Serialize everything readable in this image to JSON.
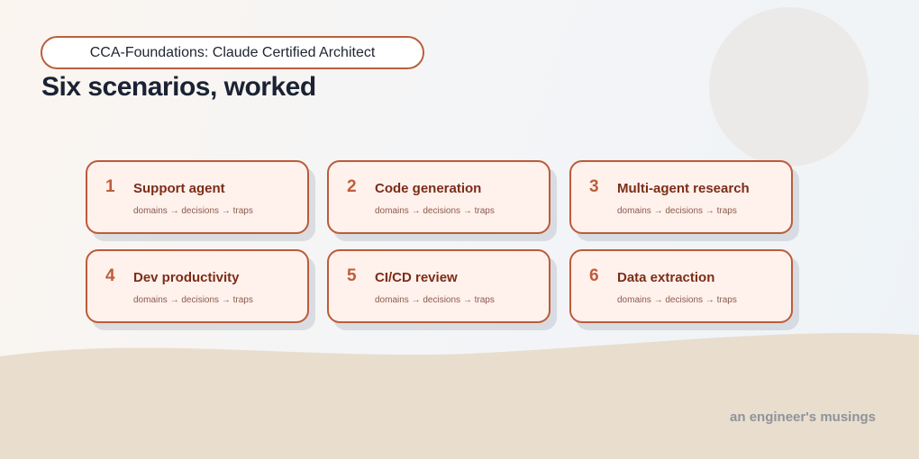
{
  "colors": {
    "accent": "#bd5b38",
    "card_bg": "#fff1ec",
    "title_text": "#1a2233",
    "card_title": "#7c2d17",
    "wave": "#e9ddcd"
  },
  "header": {
    "badge": "CCA-Foundations: Claude Certified Architect",
    "title": "Six scenarios, worked"
  },
  "cards": [
    {
      "num": "1",
      "title": "Support agent",
      "subtitle": "domains → decisions → traps"
    },
    {
      "num": "2",
      "title": "Code generation",
      "subtitle": "domains → decisions → traps"
    },
    {
      "num": "3",
      "title": "Multi-agent research",
      "subtitle": "domains → decisions → traps"
    },
    {
      "num": "4",
      "title": "Dev productivity",
      "subtitle": "domains → decisions → traps"
    },
    {
      "num": "5",
      "title": "CI/CD review",
      "subtitle": "domains → decisions → traps"
    },
    {
      "num": "6",
      "title": "Data extraction",
      "subtitle": "domains → decisions → traps"
    }
  ],
  "footer": {
    "text": "an engineer's musings"
  }
}
